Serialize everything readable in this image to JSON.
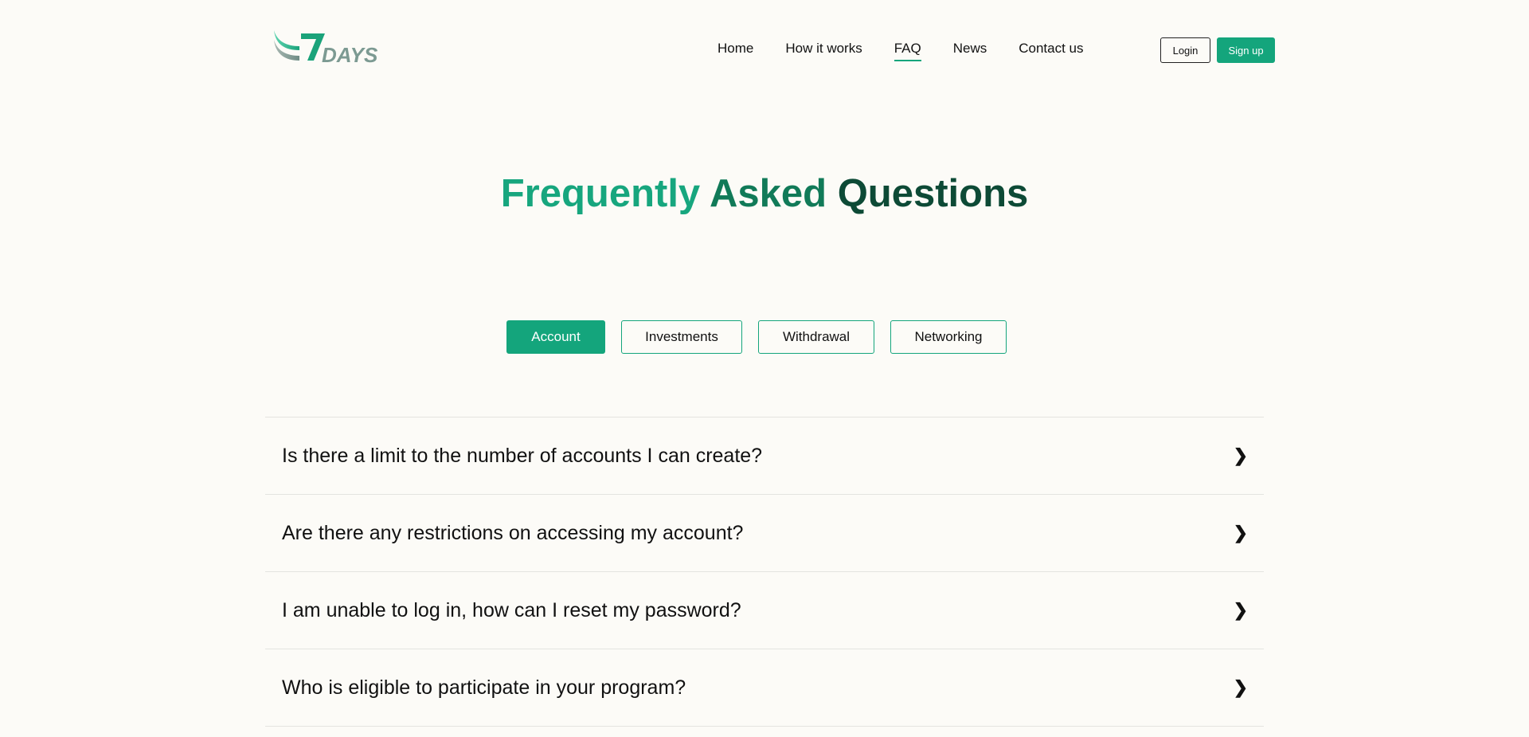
{
  "header": {
    "logo_text": "7DAYS",
    "nav": [
      {
        "label": "Home",
        "active": false
      },
      {
        "label": "How it works",
        "active": false
      },
      {
        "label": "FAQ",
        "active": true
      },
      {
        "label": "News",
        "active": false
      },
      {
        "label": "Contact us",
        "active": false
      }
    ],
    "login_label": "Login",
    "signup_label": "Sign up"
  },
  "hero": {
    "title_part1": "Frequently",
    "title_part2": "Asked",
    "title_part3": "Questions"
  },
  "tabs": [
    {
      "label": "Account",
      "active": true
    },
    {
      "label": "Investments",
      "active": false
    },
    {
      "label": "Withdrawal",
      "active": false
    },
    {
      "label": "Networking",
      "active": false
    }
  ],
  "faq": [
    {
      "question": "Is there a limit to the number of accounts I can create?",
      "icon": "chevron-right-icon"
    },
    {
      "question": "Are there any restrictions on accessing my account?",
      "icon": "chevron-right-icon"
    },
    {
      "question": "I am unable to log in, how can I reset my password?",
      "icon": "chevron-right-icon"
    },
    {
      "question": "Who is eligible to participate in your program?",
      "icon": "chevron-right-icon"
    }
  ],
  "colors": {
    "accent": "#14a57c",
    "background": "#fcfbf7",
    "title_dark": "#0d4a36"
  }
}
